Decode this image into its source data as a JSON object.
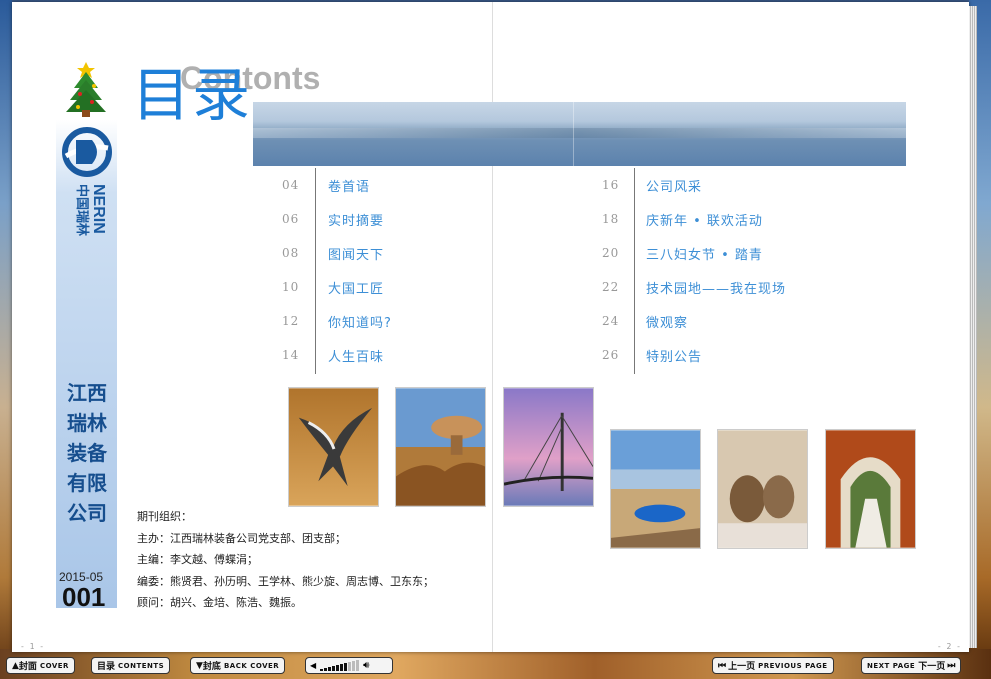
{
  "toc": {
    "title_cn": "目录",
    "title_en": "Contonts",
    "left": [
      {
        "num": "04",
        "label": "卷首语"
      },
      {
        "num": "06",
        "label": "实时摘要"
      },
      {
        "num": "08",
        "label": "图闻天下"
      },
      {
        "num": "10",
        "label": "大国工匠"
      },
      {
        "num": "12",
        "label": "你知道吗?"
      },
      {
        "num": "14",
        "label": "人生百味"
      }
    ],
    "right": [
      {
        "num": "16",
        "label": "公司风采"
      },
      {
        "num": "18",
        "label": "庆新年 • 联欢活动"
      },
      {
        "num": "20",
        "label": "三八妇女节 • 踏青"
      },
      {
        "num": "22",
        "label": "技术园地——我在现场"
      },
      {
        "num": "24",
        "label": "微观察"
      },
      {
        "num": "26",
        "label": "特别公告"
      }
    ]
  },
  "sidebar": {
    "logo_cn": "中国瑞林",
    "logo_en": "NERIN",
    "company": [
      "江",
      "西",
      "瑞",
      "林",
      "装",
      "备",
      "有",
      "限",
      "公",
      "司"
    ],
    "issue_date": "2015-05",
    "issue_no": "001"
  },
  "editors": {
    "heading": "期刊组织：",
    "host": "主办：江西瑞林装备公司党支部、团支部；",
    "chief": "主编：李文越、傅蝶涓；",
    "committee": "编委：熊贤君、孙历明、王学林、熊少旋、周志博、卫东东；",
    "advisors": "顾问：胡兴、金培、陈浩、魏振。"
  },
  "page_numbers": {
    "left": "- 1 -",
    "right": "- 2 -"
  },
  "controls": {
    "cover_cn": "封面",
    "cover_en": "COVER",
    "contents_cn": "目录",
    "contents_en": "CONTENTS",
    "back_cn": "封底",
    "back_en": "BACK COVER",
    "prev_cn": "上一页",
    "prev_en": "PREVIOUS PAGE",
    "next_en": "NEXT PAGE",
    "next_cn": "下一页"
  },
  "volume_level": 0.65,
  "colors": {
    "accent": "#1e7fd8",
    "toc_label": "#3d8fd6",
    "company": "#164e8e"
  }
}
